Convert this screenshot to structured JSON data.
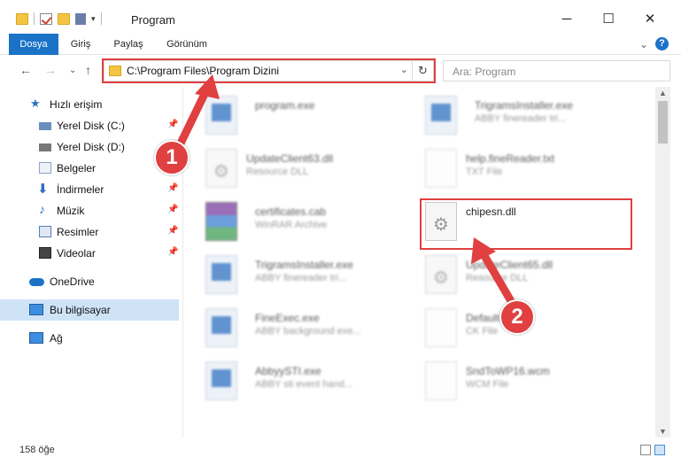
{
  "window": {
    "title": "Program",
    "minimize": "─",
    "maximize": "☐",
    "close": "✕"
  },
  "ribbon": {
    "tabs": [
      "Dosya",
      "Giriş",
      "Paylaş",
      "Görünüm"
    ],
    "expand": "⌄",
    "help": "?"
  },
  "nav": {
    "back": "←",
    "forward": "→",
    "recent": "⌄",
    "up": "↑",
    "address_path": "C:\\Program Files\\Program Dizini",
    "address_chevron": "⌄",
    "refresh": "↻",
    "search_placeholder": "Ara: Program"
  },
  "sidebar": {
    "items": [
      {
        "label": "Hızlı erişim",
        "icon": "star-icon",
        "pinned": false
      },
      {
        "label": "Yerel Disk (C:)",
        "icon": "drive-icon",
        "pinned": true
      },
      {
        "label": "Yerel Disk (D:)",
        "icon": "drive-icon",
        "pinned": true
      },
      {
        "label": "Belgeler",
        "icon": "documents-icon",
        "pinned": true
      },
      {
        "label": "İndirmeler",
        "icon": "download-icon",
        "pinned": true
      },
      {
        "label": "Müzik",
        "icon": "music-icon",
        "pinned": true
      },
      {
        "label": "Resimler",
        "icon": "pictures-icon",
        "pinned": true
      },
      {
        "label": "Videolar",
        "icon": "videos-icon",
        "pinned": true
      },
      {
        "label": "OneDrive",
        "icon": "cloud-icon",
        "pinned": false
      },
      {
        "label": "Bu bilgisayar",
        "icon": "computer-icon",
        "pinned": false
      },
      {
        "label": "Ağ",
        "icon": "network-icon",
        "pinned": false
      }
    ],
    "pin_glyph": "📌"
  },
  "files": [
    {
      "name": "program.exe",
      "desc": "",
      "type": "exe"
    },
    {
      "name": "TrigramsInstaller.exe",
      "desc": "ABBY finereader tri...",
      "type": "exe"
    },
    {
      "name": "UpdateClient63.dll",
      "desc": "Resource DLL",
      "type": "dll"
    },
    {
      "name": "help.fineReader.txt",
      "desc": "TXT File",
      "type": "txt"
    },
    {
      "name": "certificates.cab",
      "desc": "WinRAR Archive",
      "type": "rar"
    },
    {
      "name": "chipesn.dll",
      "desc": "",
      "type": "dll"
    },
    {
      "name": "TrigramsInstaller.exe",
      "desc": "ABBY finereader tri...",
      "type": "exe"
    },
    {
      "name": "UpdateClient65.dll",
      "desc": "Resource DLL",
      "type": "dll"
    },
    {
      "name": "FineExec.exe",
      "desc": "ABBY background exe...",
      "type": "exe"
    },
    {
      "name": "Default...ck",
      "desc": "CK File",
      "type": "txt"
    },
    {
      "name": "AbbyySTI.exe",
      "desc": "ABBY sti event hand...",
      "type": "exe"
    },
    {
      "name": "SndToWP16.wcm",
      "desc": "WCM File",
      "type": "txt"
    }
  ],
  "status": {
    "count": "158 öğe"
  },
  "callouts": [
    "1",
    "2"
  ],
  "colors": {
    "accent": "#1a73c7",
    "highlight": "#e04040",
    "selection": "#cfe3f7"
  }
}
